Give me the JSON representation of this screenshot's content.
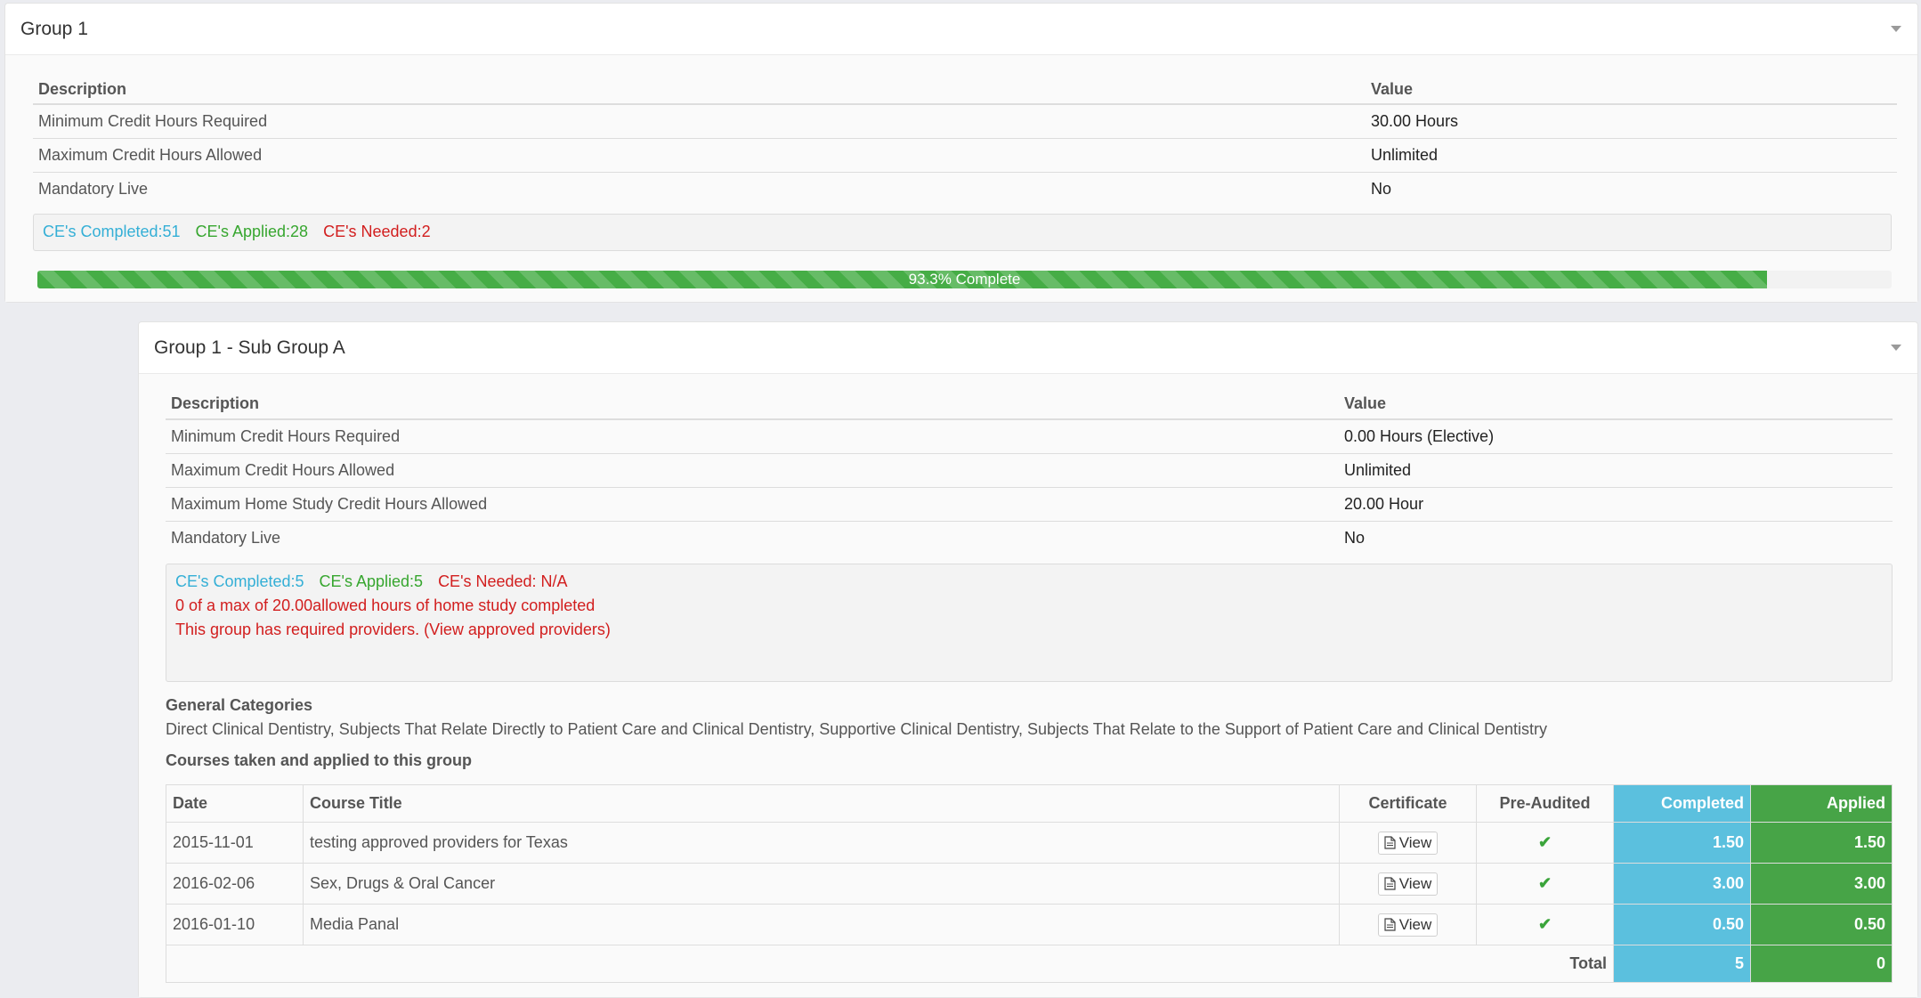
{
  "group1": {
    "title": "Group 1",
    "table": {
      "headers": [
        "Description",
        "Value"
      ],
      "rows": [
        {
          "desc": "Minimum Credit Hours Required",
          "value": "30.00 Hours"
        },
        {
          "desc": "Maximum Credit Hours Allowed",
          "value": "Unlimited"
        },
        {
          "desc": "Mandatory Live",
          "value": "No"
        }
      ]
    },
    "stats": {
      "completed": "CE's Completed:51",
      "applied": "CE's Applied:28",
      "needed": "CE's Needed:2"
    },
    "progress": {
      "percent": 93.3,
      "label": "93.3% Complete"
    }
  },
  "subgroup": {
    "title": "Group 1 - Sub Group A",
    "table": {
      "headers": [
        "Description",
        "Value"
      ],
      "rows": [
        {
          "desc": "Minimum Credit Hours Required",
          "value": "0.00 Hours (Elective)"
        },
        {
          "desc": "Maximum Credit Hours Allowed",
          "value": "Unlimited"
        },
        {
          "desc": "Maximum Home Study Credit Hours Allowed",
          "value": "20.00 Hour"
        },
        {
          "desc": "Mandatory Live",
          "value": "No"
        }
      ]
    },
    "stats": {
      "completed": "CE's Completed:5",
      "applied": "CE's Applied:5",
      "needed": "CE's Needed: N/A",
      "home_study": "0 of a max of 20.00allowed hours of home study completed",
      "providers": "This group has required providers. (View approved providers)"
    },
    "categories_title": "General Categories",
    "categories_text": "Direct Clinical Dentistry, Subjects That Relate Directly to Patient Care and Clinical Dentistry, Supportive Clinical Dentistry, Subjects That Relate to the Support of Patient Care and Clinical Dentistry",
    "courses_title": "Courses taken and applied to this group",
    "courses": {
      "headers": {
        "date": "Date",
        "title": "Course Title",
        "certificate": "Certificate",
        "pre_audited": "Pre-Audited",
        "completed": "Completed",
        "applied": "Applied"
      },
      "rows": [
        {
          "date": "2015-11-01",
          "title": "testing approved providers for Texas",
          "view": "View",
          "completed": "1.50",
          "applied": "1.50"
        },
        {
          "date": "2016-02-06",
          "title": "Sex, Drugs & Oral Cancer",
          "view": "View",
          "completed": "3.00",
          "applied": "3.00"
        },
        {
          "date": "2016-01-10",
          "title": "Media Panal",
          "view": "View",
          "completed": "0.50",
          "applied": "0.50"
        }
      ],
      "total_label": "Total",
      "total_completed": "5",
      "total_applied": "0"
    }
  }
}
